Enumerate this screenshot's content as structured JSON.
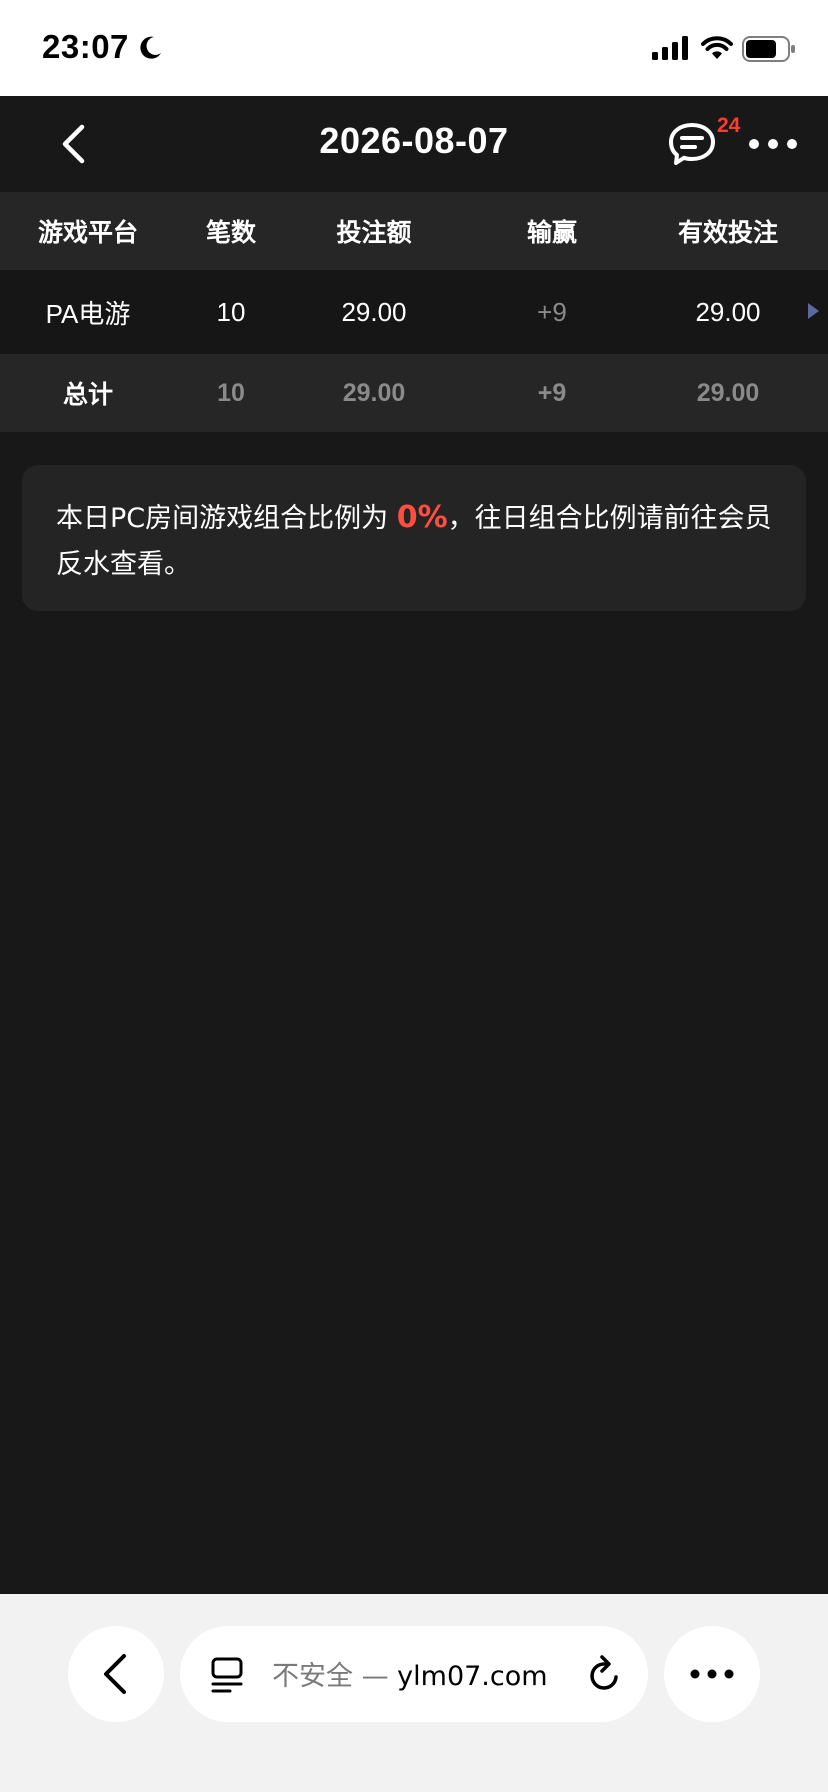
{
  "status_bar": {
    "time": "23:07"
  },
  "nav": {
    "title": "2026-08-07",
    "message_badge": "24"
  },
  "table": {
    "columns": [
      "游戏平台",
      "笔数",
      "投注额",
      "输赢",
      "有效投注"
    ],
    "rows": [
      {
        "platform": "PA电游",
        "count": "10",
        "bet": "29.00",
        "win_loss": "+9",
        "valid_bet": "29.00"
      }
    ],
    "total": {
      "label": "总计",
      "count": "10",
      "bet": "29.00",
      "win_loss": "+9",
      "valid_bet": "29.00"
    }
  },
  "notice": {
    "prefix": "本日PC房间游戏组合比例为 ",
    "percent": "0%",
    "suffix": "，往日组合比例请前往会员反水查看。"
  },
  "browser": {
    "insecure_label": "不安全",
    "separator": " — ",
    "domain": "ylm07.com"
  },
  "colors": {
    "accent_red": "#ff4d40",
    "background": "#181818",
    "row_alt": "#262626"
  }
}
